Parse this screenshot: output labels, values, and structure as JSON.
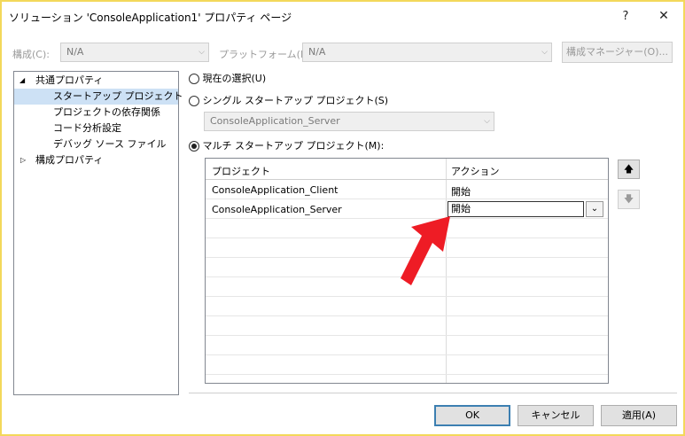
{
  "window": {
    "title": "ソリューション 'ConsoleApplication1' プロパティ ページ",
    "help_glyph": "?",
    "close_glyph": "✕"
  },
  "toolbar": {
    "config_label": "構成(C):",
    "config_value": "N/A",
    "platform_label": "プラットフォーム(P):",
    "platform_value": "N/A",
    "config_manager_button": "構成マネージャー(O)..."
  },
  "tree": {
    "items": [
      {
        "label": "共通プロパティ",
        "expander": "◢"
      },
      {
        "label": "スタートアップ プロジェクト"
      },
      {
        "label": "プロジェクトの依存関係"
      },
      {
        "label": "コード分析設定"
      },
      {
        "label": "デバッグ ソース ファイル"
      },
      {
        "label": "構成プロパティ",
        "expander": "▷"
      }
    ]
  },
  "options": {
    "current_selection": "現在の選択(U)",
    "single_startup": "シングル スタートアップ プロジェクト(S)",
    "single_value": "ConsoleApplication_Server",
    "multi_startup": "マルチ スタートアップ プロジェクト(M):"
  },
  "grid": {
    "headers": {
      "project": "プロジェクト",
      "action": "アクション"
    },
    "rows": [
      {
        "project": "ConsoleApplication_Client",
        "action": "開始"
      },
      {
        "project": "ConsoleApplication_Server",
        "action": "開始"
      }
    ]
  },
  "move_buttons": {
    "up": "🡅",
    "down": "🡇"
  },
  "footer": {
    "ok": "OK",
    "cancel": "キャンセル",
    "apply": "適用(A)"
  },
  "colors": {
    "arrow": "#ee1c25",
    "focus_border": "#f3d85a",
    "selection": "#cde1f5"
  }
}
